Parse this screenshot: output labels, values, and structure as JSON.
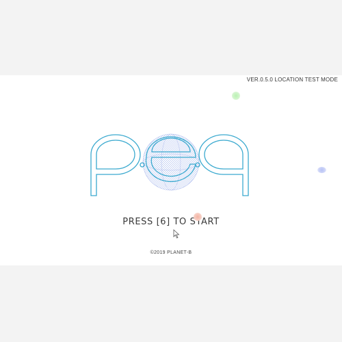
{
  "header": {
    "version_label": "VER.0.5.0 LOCATION TEST MODE"
  },
  "title_screen": {
    "logo_text": "peq",
    "start_prompt": "PRESS [6] TO START",
    "copyright": "©2019 PLANET-B"
  },
  "colors": {
    "logo_stroke": "#3aa9cf",
    "sphere": "#9aaee8",
    "orb_green": "#b9f2b3",
    "orb_blue": "#b7c2f5",
    "orb_red": "#f3b3a3"
  },
  "icons": [
    "mouse-cursor-icon",
    "wireframe-sphere-icon"
  ]
}
